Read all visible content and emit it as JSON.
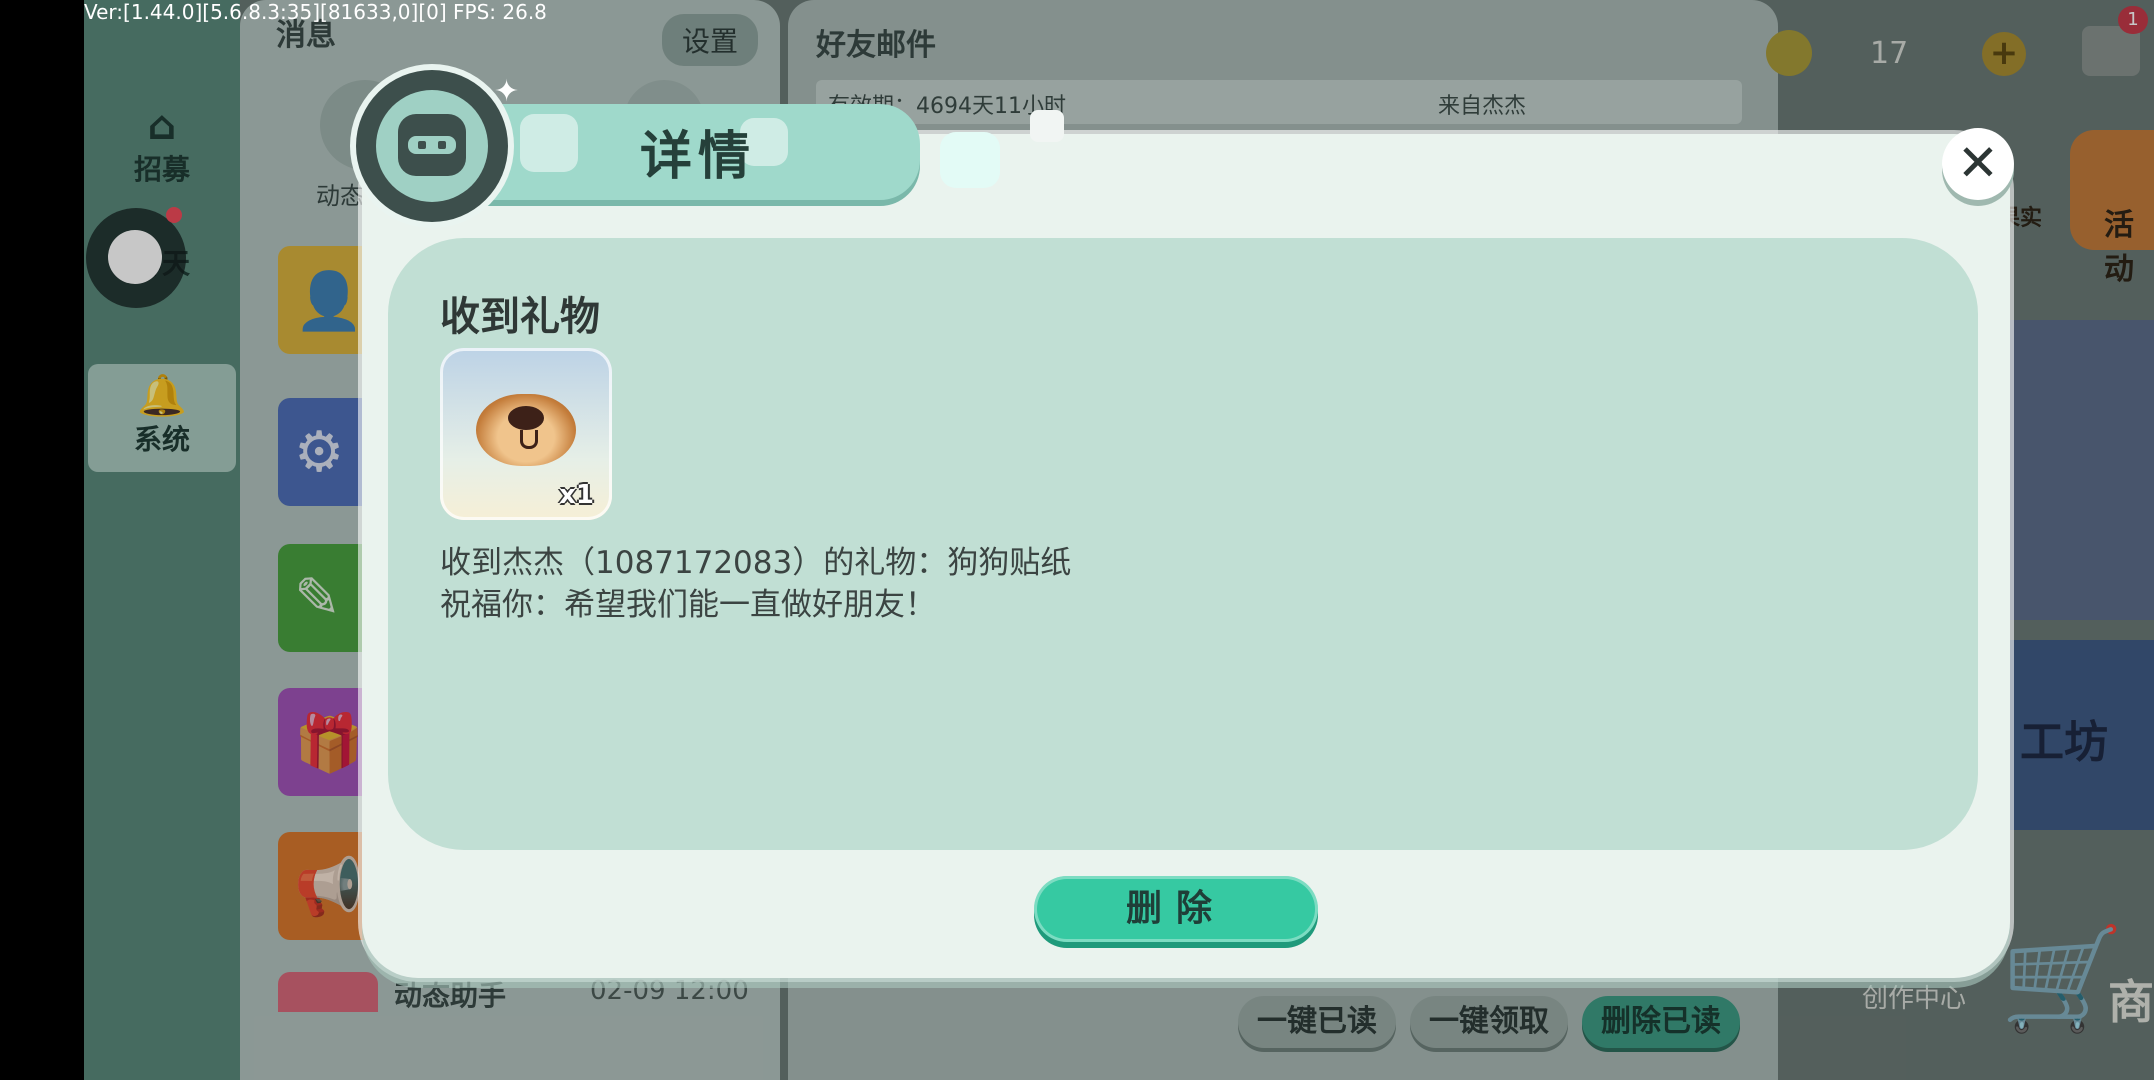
{
  "debug": {
    "text": "Ver:[1.44.0][5.6.8.3:35][81633,0][0] FPS: 26.8"
  },
  "nav": {
    "recruit": "招募",
    "chat": "聊天",
    "system": "系统"
  },
  "messages": {
    "title": "消息",
    "settings": "设置",
    "dynamic_label": "动态",
    "bottom_item": {
      "title": "动态助手",
      "time": "02-09 12:00"
    }
  },
  "mail": {
    "title": "好友邮件",
    "row": {
      "expiry": "有效期：4694天11小时",
      "from": "来自杰杰"
    },
    "buttons": {
      "read_all": "一键已读",
      "claim_all": "一键领取",
      "delete_read": "删除已读"
    }
  },
  "hud": {
    "coin_count": "17",
    "mail_badge": "1",
    "activity": "活动",
    "side": "果实",
    "workshop": "工坊",
    "create_center": "创作中心",
    "shop": "商"
  },
  "dialog": {
    "title": "详情",
    "section_title": "收到礼物",
    "gift": {
      "icon": "dog-sticker-icon",
      "quantity": "x1"
    },
    "line1": "收到杰杰（1087172083）的礼物：狗狗贴纸",
    "line2": "祝福你：希望我们能一直做好朋友！",
    "delete_label": "删除",
    "close_icon": "close-icon"
  },
  "colors": {
    "accent": "#36c9a2",
    "dialog_bg": "#eaf3ee",
    "content_bg": "#c1dfd4",
    "header_tab": "#9fd9cb"
  }
}
